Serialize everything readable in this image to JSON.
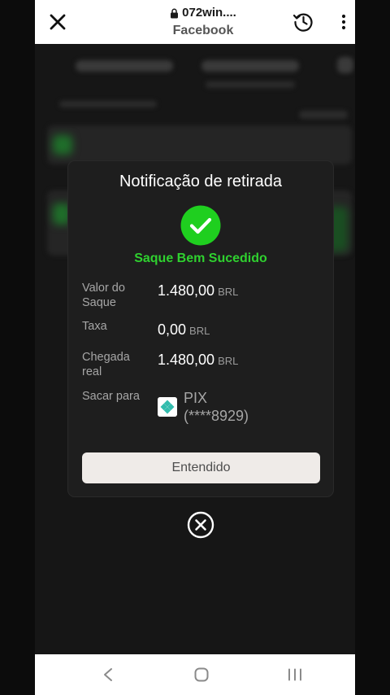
{
  "browser": {
    "url": "072win....",
    "subtitle": "Facebook"
  },
  "modal": {
    "title": "Notificação de retirada",
    "status": "Saque Bem Sucedido",
    "rows": [
      {
        "label": "Valor do Saque",
        "value": "1.480,00",
        "unit": "BRL"
      },
      {
        "label": "Taxa",
        "value": "0,00",
        "unit": "BRL"
      },
      {
        "label": "Chegada real",
        "value": "1.480,00",
        "unit": "BRL"
      }
    ],
    "destination": {
      "label": "Sacar para",
      "method": "PIX",
      "account": "(****8929)"
    },
    "button_label": "Entendido"
  },
  "colors": {
    "success": "#2fd12f",
    "accent_green": "#1fcf1f"
  },
  "icons": {
    "close": "close-icon",
    "lock": "lock-icon",
    "history": "history-icon",
    "menu": "more-vert-icon",
    "check": "check-circle-icon",
    "pix": "pix-icon",
    "dismiss": "close-circle-icon",
    "nav_back": "back-icon",
    "nav_home": "home-icon",
    "nav_recent": "recent-apps-icon"
  }
}
